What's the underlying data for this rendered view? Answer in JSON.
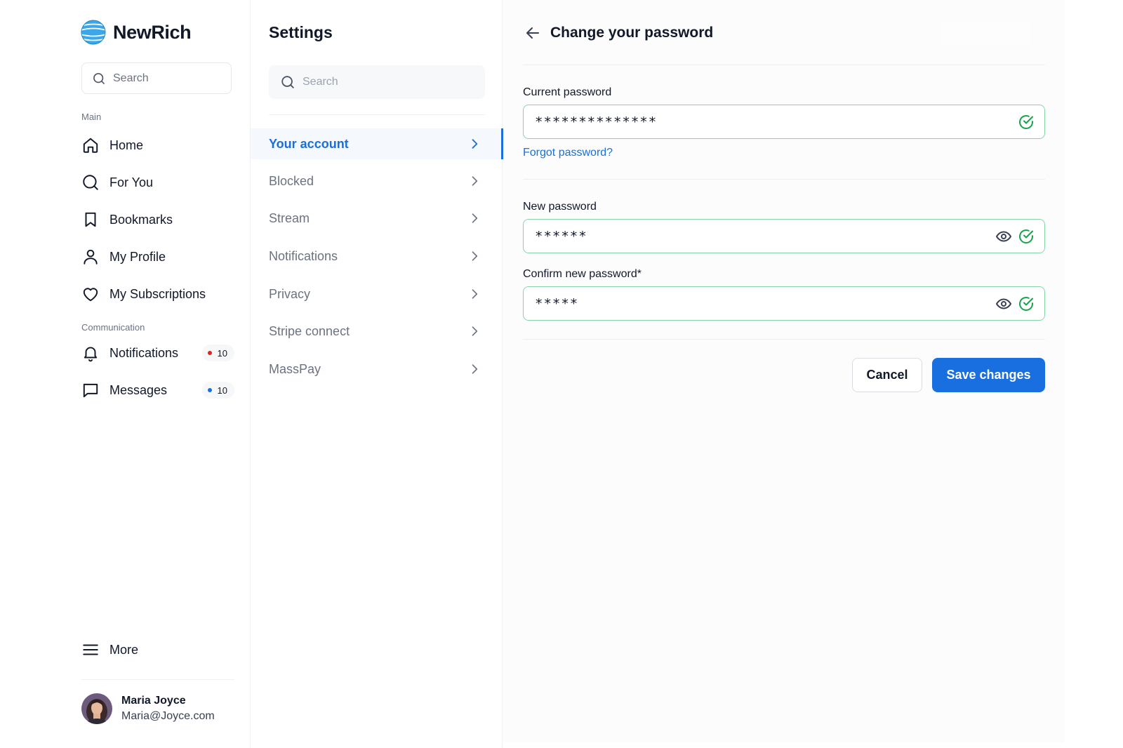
{
  "brand": {
    "name": "NewRich",
    "logo_icon": "globe-logo-icon",
    "accent": "#3aa7e8"
  },
  "sidebar": {
    "search_placeholder": "Search",
    "section_main": "Main",
    "section_communication": "Communication",
    "main_items": [
      {
        "label": "Home",
        "icon": "home-icon"
      },
      {
        "label": "For You",
        "icon": "search-icon"
      },
      {
        "label": "Bookmarks",
        "icon": "bookmark-icon"
      },
      {
        "label": "My Profile",
        "icon": "user-icon"
      },
      {
        "label": "My Subscriptions",
        "icon": "heart-icon"
      }
    ],
    "communication_items": [
      {
        "label": "Notifications",
        "icon": "bell-icon",
        "badge": "10",
        "dot_color": "#dc2626"
      },
      {
        "label": "Messages",
        "icon": "message-icon",
        "badge": "10",
        "dot_color": "#1a6fd8"
      }
    ],
    "more_label": "More",
    "user": {
      "name": "Maria Joyce",
      "email": "Maria@Joyce.com"
    }
  },
  "settings": {
    "title": "Settings",
    "search_placeholder": "Search",
    "items": [
      {
        "label": "Your account",
        "active": true
      },
      {
        "label": "Blocked"
      },
      {
        "label": "Stream"
      },
      {
        "label": "Notifications"
      },
      {
        "label": "Privacy"
      },
      {
        "label": "Stripe connect"
      },
      {
        "label": "MassPay"
      }
    ]
  },
  "main": {
    "title": "Change your password",
    "current_password_label": "Current password",
    "current_password_value": "**************",
    "forgot_label": "Forgot password?",
    "new_password_label": "New password",
    "new_password_value": "******",
    "confirm_password_label": "Confirm new password*",
    "confirm_password_value": "*****",
    "cancel_label": "Cancel",
    "save_label": "Save changes",
    "valid_color": "#16a34a",
    "primary_color": "#1a6fe0"
  }
}
